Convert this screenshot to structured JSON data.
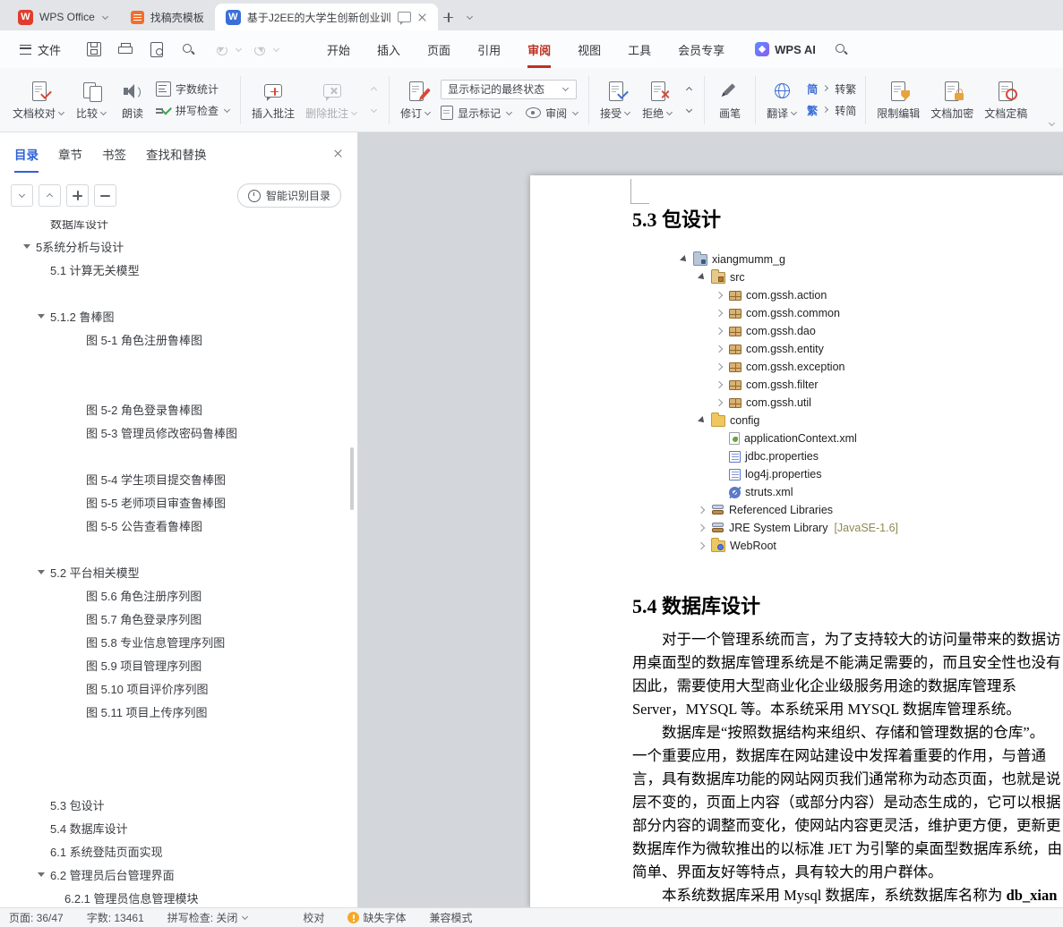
{
  "titlebar": {
    "logo": "W",
    "tabs": [
      {
        "label": "WPS Office"
      },
      {
        "label": "找稿壳模板"
      },
      {
        "label": "基于J2EE的大学生创新创业训"
      }
    ]
  },
  "menubar": {
    "file": "文件",
    "quick_icons": [
      "save-icon",
      "print-icon",
      "print-preview-icon",
      "find-icon",
      "undo-icon",
      "redo-icon"
    ],
    "items": [
      "开始",
      "插入",
      "页面",
      "引用",
      "审阅",
      "视图",
      "工具",
      "会员专享"
    ],
    "active_item": "审阅",
    "wps_ai": "WPS AI"
  },
  "ribbon": {
    "doc_proof": "文档校对",
    "compare": "比较",
    "read": "朗读",
    "word_count": "字数统计",
    "spell_check": "拼写检查",
    "insert_comment": "插入批注",
    "delete_comment": "删除批注",
    "revise": "修订",
    "markup_combo": "显示标记的最终状态",
    "show_markup": "显示标记",
    "review": "审阅",
    "accept": "接受",
    "reject": "拒绝",
    "brush": "画笔",
    "translate": "翻译",
    "jian": "简",
    "fan": "繁",
    "to_trad": "转繁",
    "to_simp": "转简",
    "restrict": "限制编辑",
    "encrypt": "文档加密",
    "finalize": "文档定稿"
  },
  "sidebar": {
    "tabs": [
      "目录",
      "章节",
      "书签",
      "查找和替换"
    ],
    "active_tab": "目录",
    "smart_toc": "智能识别目录",
    "toc": [
      {
        "label": "数据库设计"
      },
      {
        "label": "5系统分析与设计"
      },
      {
        "label": "5.1 计算无关模型"
      },
      {
        "label": "5.1.2 鲁棒图"
      },
      {
        "label": "图 5-1 角色注册鲁棒图"
      },
      {
        "label": "图 5-2 角色登录鲁棒图"
      },
      {
        "label": "图 5-3 管理员修改密码鲁棒图"
      },
      {
        "label": "图 5-4 学生项目提交鲁棒图"
      },
      {
        "label": "图 5-5 老师项目审查鲁棒图"
      },
      {
        "label": "图 5-5 公告查看鲁棒图"
      },
      {
        "label": "5.2 平台相关模型"
      },
      {
        "label": "图 5.6 角色注册序列图"
      },
      {
        "label": "图 5.7 角色登录序列图"
      },
      {
        "label": "图 5.8 专业信息管理序列图"
      },
      {
        "label": "图 5.9 项目管理序列图"
      },
      {
        "label": "图 5.10 项目评价序列图"
      },
      {
        "label": "图 5.11 项目上传序列图"
      },
      {
        "label": "5.3 包设计"
      },
      {
        "label": "5.4 数据库设计"
      },
      {
        "label": "6.1 系统登陆页面实现"
      },
      {
        "label": "6.2 管理员后台管理界面"
      },
      {
        "label": "6.2.1 管理员信息管理模块"
      }
    ]
  },
  "document": {
    "heading_53": "5.3 包设计",
    "heading_54": "5.4 数据库设计",
    "project_tree": [
      {
        "label": "xiangmumm_g"
      },
      {
        "label": "src"
      },
      {
        "label": "com.gssh.action"
      },
      {
        "label": "com.gssh.common"
      },
      {
        "label": "com.gssh.dao"
      },
      {
        "label": "com.gssh.entity"
      },
      {
        "label": "com.gssh.exception"
      },
      {
        "label": "com.gssh.filter"
      },
      {
        "label": "com.gssh.util"
      },
      {
        "label": "config"
      },
      {
        "label": "applicationContext.xml"
      },
      {
        "label": "jdbc.properties"
      },
      {
        "label": "log4j.properties"
      },
      {
        "label": "struts.xml"
      },
      {
        "label": "Referenced Libraries"
      },
      {
        "label": "JRE System Library",
        "decorator": "[JavaSE-1.6]"
      },
      {
        "label": "WebRoot"
      }
    ],
    "body_lines": [
      "对于一个管理系统而言，为了支持较大的访问量带来的数据访",
      "用桌面型的数据库管理系统是不能满足需要的，而且安全性也没有",
      "因此，需要使用大型商业化企业级服务用途的数据库管理系",
      "Server，MYSQL 等。本系统采用 MYSQL 数据库管理系统。",
      "数据库是“按照数据结构来组织、存储和管理数据的仓库”。",
      "一个重要应用，数据库在网站建设中发挥着重要的作用，与普通",
      "言，具有数据库功能的网站网页我们通常称为动态页面，也就是说",
      "层不变的，页面上内容（或部分内容）是动态生成的，它可以根据",
      "部分内容的调整而变化，使网站内容更灵活，维护更方便，更新更",
      "数据库作为微软推出的以标准 JET 为引擎的桌面型数据库系统，由",
      "简单、界面友好等特点，具有较大的用户群体。"
    ],
    "last_line": {
      "normal": "本系统数据库采用 Mysql 数据库，系统数据库名称为 ",
      "bold": "db_xian"
    }
  },
  "statusbar": {
    "page": "页面: 36/47",
    "words": "字数: 13461",
    "spell": "拼写检查: 关闭",
    "proof": "校对",
    "missing_font": "缺失字体",
    "compat": "兼容模式"
  }
}
